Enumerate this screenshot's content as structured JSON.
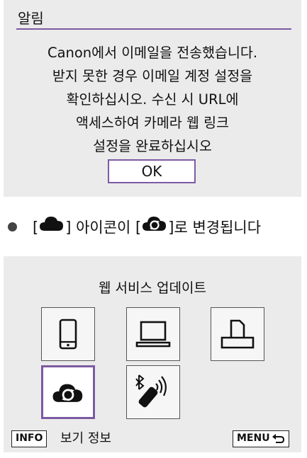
{
  "dialog": {
    "title": "알림",
    "message_lines": [
      "Canon에서 이메일을 전송했습니다.",
      "받지 못한 경우 이메일 계정 설정을",
      "확인하십시오. 수신 시 URL에",
      "액세스하여 카메라 웹 링크",
      "설정을 완료하십시오"
    ],
    "ok_label": "OK"
  },
  "note": {
    "open_bracket_1": "[",
    "close_bracket_1": "]",
    "text_middle": " 아이콘이 ",
    "open_bracket_2": "[",
    "close_bracket_2": "]",
    "text_end": "로 변경됩니다"
  },
  "screen": {
    "title": "웹 서비스 업데이트",
    "info_key": "INFO",
    "info_label": "보기 정보",
    "menu_key": "MENU"
  },
  "colors": {
    "accent": "#7c5aa3",
    "panel": "#ebebeb"
  }
}
